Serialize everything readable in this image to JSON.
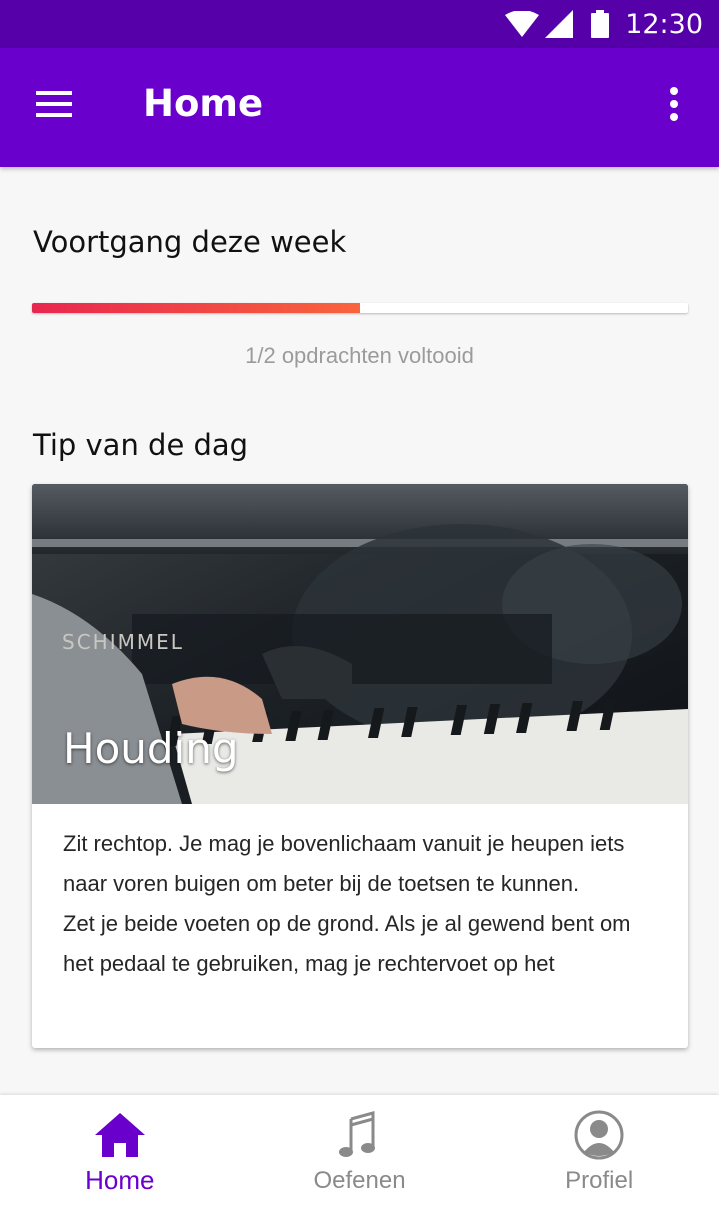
{
  "status_bar": {
    "time": "12:30",
    "icons": [
      "wifi-icon",
      "signal-icon",
      "battery-icon"
    ]
  },
  "app_bar": {
    "title": "Home",
    "icons": [
      "menu-icon",
      "more-vert-icon"
    ],
    "color": "#6a00cc"
  },
  "progress": {
    "title": "Voortgang deze week",
    "completed": 1,
    "total": 2,
    "fraction": 0.5,
    "label": "1/2 opdrachten voltooid",
    "colors": [
      "#e8274f",
      "#f8643c"
    ]
  },
  "tip": {
    "section_title": "Tip van de dag",
    "heading": "Houding",
    "paragraphs": [
      "Zit rechtop.  Je mag je bovenlichaam vanuit je heupen iets naar voren buigen om beter bij de toetsen te kunnen.",
      "Zet je beide voeten op de grond. Als je al gewend bent om het pedaal te gebruiken, mag je rechtervoet op het"
    ],
    "image": {
      "icon": "piano-photo",
      "brand_text": "SCHIMMEL"
    }
  },
  "bottom_nav": [
    {
      "label": "Home",
      "icon": "home-icon",
      "active": true
    },
    {
      "label": "Oefenen",
      "icon": "music-note-icon",
      "active": false
    },
    {
      "label": "Profiel",
      "icon": "profile-icon",
      "active": false
    }
  ]
}
